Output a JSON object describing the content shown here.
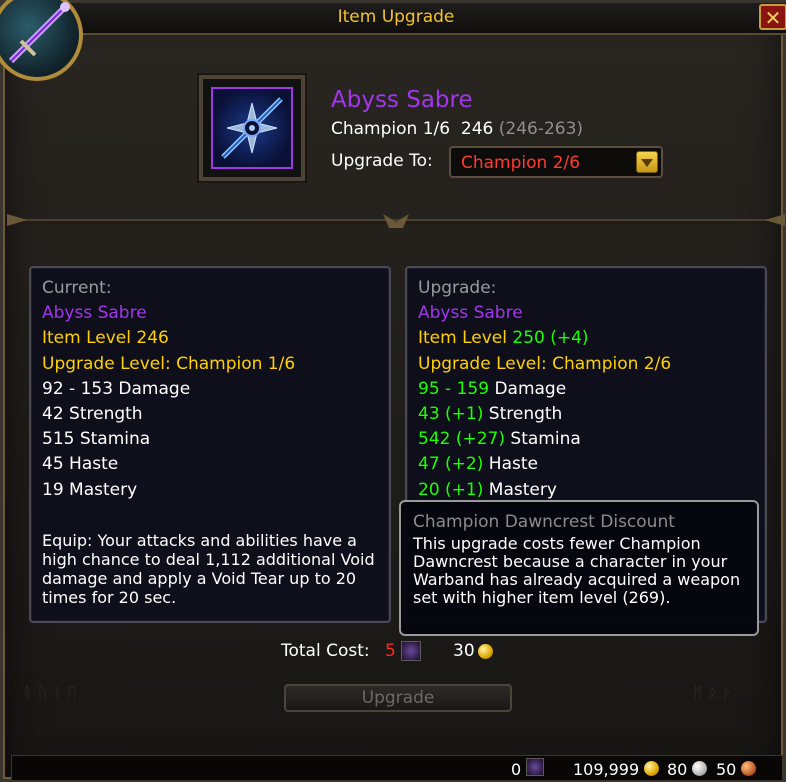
{
  "window": {
    "title": "Item Upgrade",
    "close_label": "✕"
  },
  "item": {
    "name": "Abyss Sabre",
    "track_line": "Champion 1/6  246",
    "ilvl_range": "(246-263)",
    "upgrade_to_label": "Upgrade To:",
    "upgrade_to_value": "Champion 2/6",
    "icon_name": "sword-icon"
  },
  "current": {
    "header": "Current:",
    "name": "Abyss Sabre",
    "item_level": "Item Level 246",
    "upgrade_level": "Upgrade Level: Champion 1/6",
    "damage": "92 - 153 Damage",
    "strength": "42 Strength",
    "stamina": "515 Stamina",
    "haste": "45 Haste",
    "mastery": "19 Mastery",
    "equip_text": "Equip: Your attacks and abilities have a high chance to deal 1,112 additional Void damage and apply a Void Tear up to 20 times for 20 sec."
  },
  "upgrade": {
    "header": "Upgrade:",
    "name": "Abyss Sabre",
    "item_level_label": "Item Level",
    "item_level_value": "250 (+4)",
    "upgrade_level": "Upgrade Level: Champion 2/6",
    "damage_value": "95 - 159",
    "damage_label": "Damage",
    "strength_value": "43 (+1)",
    "strength_label": "Strength",
    "stamina_value": "542 (+27)",
    "stamina_label": "Stamina",
    "haste_value": "47 (+2)",
    "haste_label": "Haste",
    "mastery_value": "20 (+1)",
    "mastery_label": "Mastery"
  },
  "tooltip": {
    "title": "Champion Dawncrest Discount",
    "body": "This upgrade costs fewer Champion Dawncrest because a character in your Warband has already acquired a weapon set with higher item level (269)."
  },
  "cost": {
    "label": "Total Cost:",
    "crest_amount": "5",
    "gold_amount": "30"
  },
  "upgrade_button_label": "Upgrade",
  "currency": {
    "crests": "0",
    "gold": "109,999",
    "silver": "80",
    "copper": "50"
  },
  "colors": {
    "title": "#f2c230",
    "epic": "#a335ee",
    "gold_text": "#ffd100",
    "green": "#1eff00",
    "red": "#ff3b2f"
  }
}
